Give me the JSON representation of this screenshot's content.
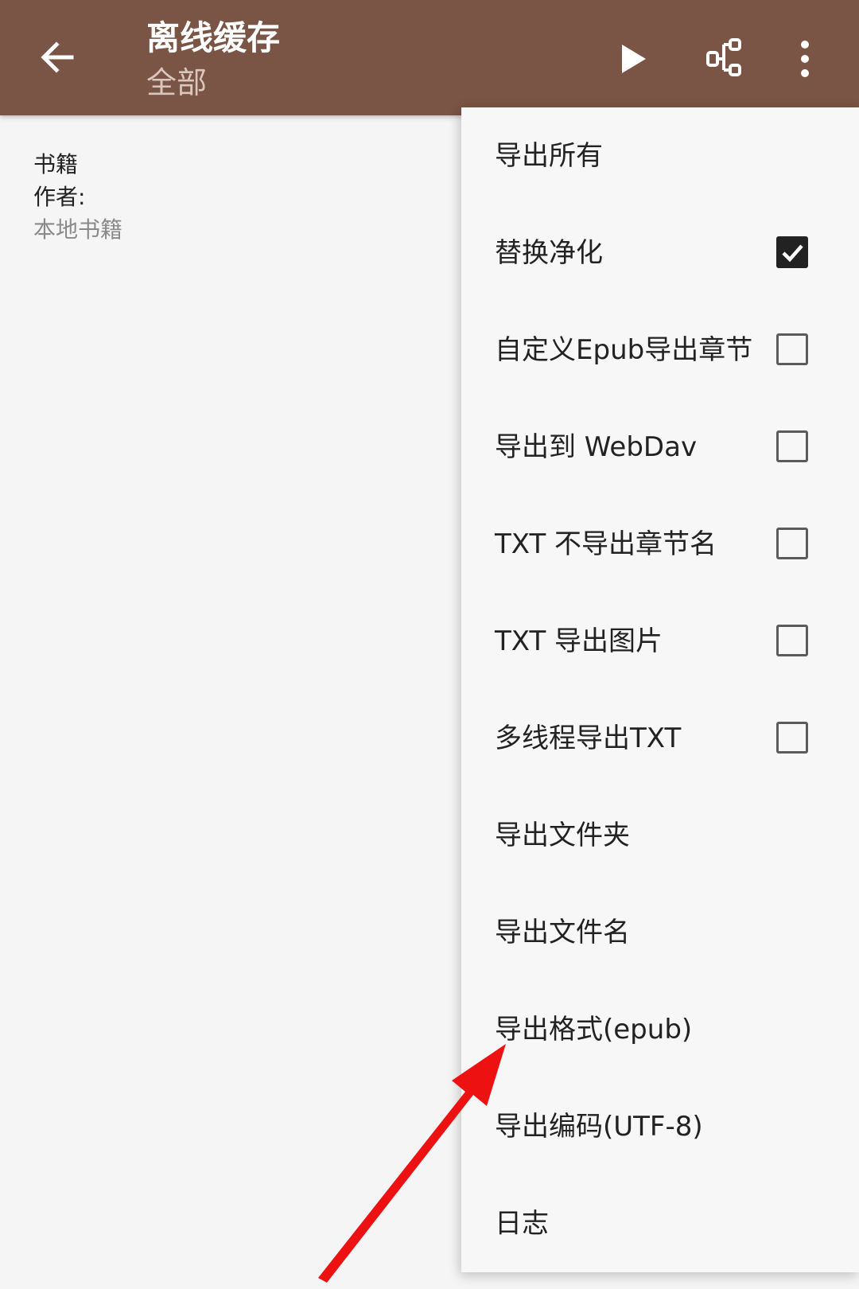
{
  "appbar": {
    "title": "离线缓存",
    "subtitle": "全部",
    "color": "#7a5444"
  },
  "icons": {
    "back": "arrow-left-icon",
    "play": "play-icon",
    "tree": "group-tree-icon",
    "more": "more-vertical-icon"
  },
  "book": {
    "name": "书籍",
    "author": "作者:",
    "origin": "本地书籍"
  },
  "menu": {
    "items": [
      {
        "label": "导出所有"
      },
      {
        "label": "替换净化",
        "checked": true
      },
      {
        "label": "自定义Epub导出章节",
        "checked": false
      },
      {
        "label": "导出到 WebDav",
        "checked": false
      },
      {
        "label": "TXT 不导出章节名",
        "checked": false
      },
      {
        "label": "TXT 导出图片",
        "checked": false
      },
      {
        "label": "多线程导出TXT",
        "checked": false
      },
      {
        "label": "导出文件夹"
      },
      {
        "label": "导出文件名"
      },
      {
        "label": "导出格式(epub)"
      },
      {
        "label": "导出编码(UTF-8)"
      },
      {
        "label": "日志"
      }
    ]
  },
  "annotation_color": "#ee1111"
}
